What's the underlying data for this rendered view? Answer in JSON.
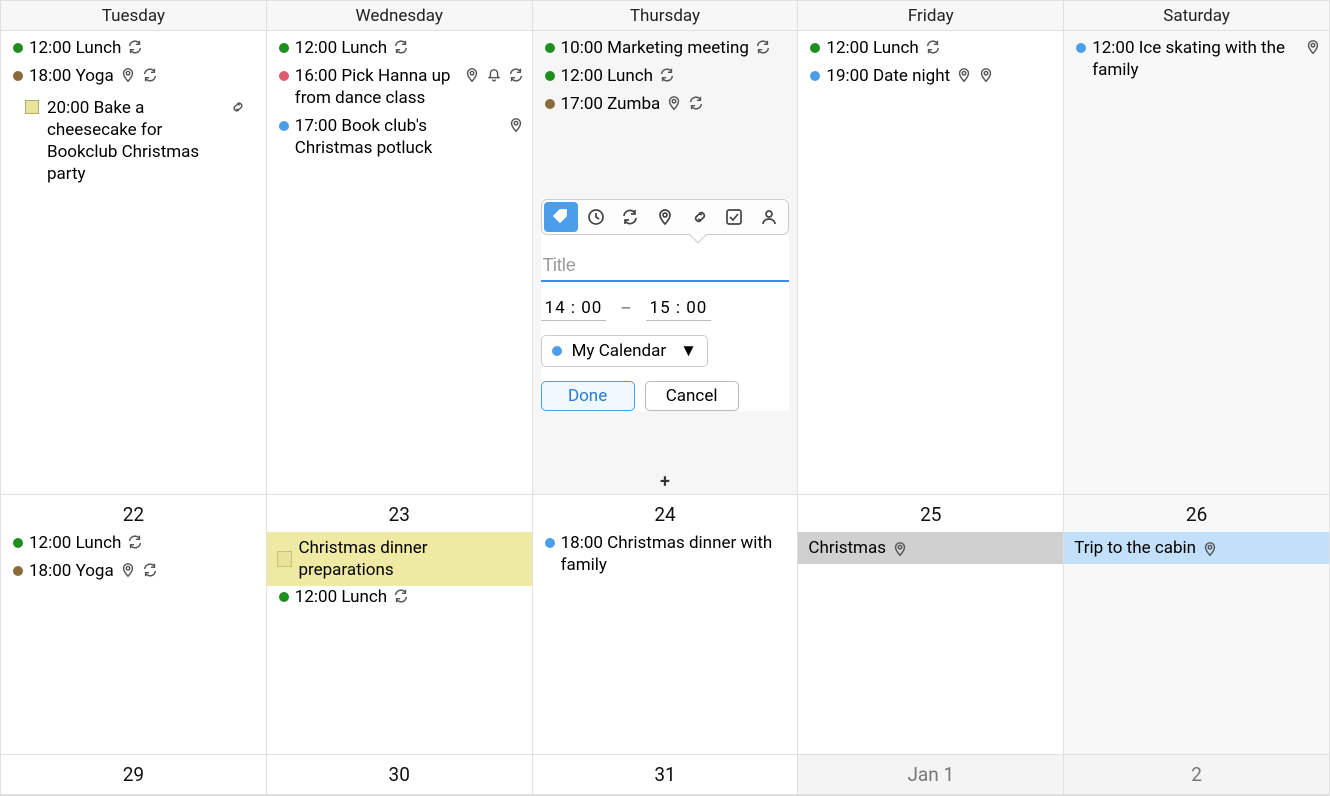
{
  "header": [
    "Tuesday",
    "Wednesday",
    "Thursday",
    "Friday",
    "Saturday"
  ],
  "weeks": [
    {
      "days": [
        {
          "date": "",
          "events": [
            {
              "color": "green",
              "time": "12:00",
              "title": "Lunch",
              "icons": [
                "repeat"
              ]
            },
            {
              "color": "brown",
              "time": "18:00",
              "title": "Yoga",
              "icons": [
                "location",
                "repeat"
              ]
            }
          ],
          "allday": [
            {
              "type": "swatch",
              "color": "yellow",
              "time": "20:00",
              "title": "Bake a cheesecake for Bookclub Christmas party",
              "icons": [
                "link"
              ]
            }
          ]
        },
        {
          "date": "",
          "events": [
            {
              "color": "green",
              "time": "12:00",
              "title": "Lunch",
              "icons": [
                "repeat"
              ]
            },
            {
              "color": "pink",
              "time": "16:00",
              "title": "Pick Hanna up from dance class",
              "icons": [
                "location",
                "bell",
                "repeat"
              ]
            },
            {
              "color": "blue",
              "time": "17:00",
              "title": "Book club's Christmas potluck",
              "icons": [
                "location"
              ]
            }
          ]
        },
        {
          "date": "",
          "today": true,
          "add": true,
          "events": [
            {
              "color": "green",
              "time": "10:00",
              "title": "Marketing meeting",
              "icons": [
                "repeat"
              ]
            },
            {
              "color": "green",
              "time": "12:00",
              "title": "Lunch",
              "icons": [
                "repeat"
              ]
            },
            {
              "color": "brown",
              "time": "17:00",
              "title": "Zumba",
              "icons": [
                "location",
                "repeat"
              ]
            }
          ],
          "popup": {
            "title_placeholder": "Title",
            "start": "14 : 00",
            "end": "15 : 00",
            "calendar": "My Calendar",
            "done": "Done",
            "cancel": "Cancel"
          }
        },
        {
          "date": "",
          "events": [
            {
              "color": "green",
              "time": "12:00",
              "title": "Lunch",
              "icons": [
                "repeat"
              ]
            },
            {
              "color": "blue",
              "time": "19:00",
              "title": "Date night",
              "icons": [
                "location",
                "location"
              ]
            }
          ]
        },
        {
          "date": "",
          "weekend": true,
          "events": [
            {
              "color": "blue",
              "time": "12:00",
              "title": "Ice skating with the family",
              "icons": [
                "location"
              ]
            }
          ]
        }
      ]
    },
    {
      "days": [
        {
          "date": "22",
          "events": [
            {
              "color": "green",
              "time": "12:00",
              "title": "Lunch",
              "icons": [
                "repeat"
              ]
            },
            {
              "color": "brown",
              "time": "18:00",
              "title": "Yoga",
              "icons": [
                "location",
                "repeat"
              ]
            }
          ]
        },
        {
          "date": "23",
          "alldaybar": [
            {
              "bg": "yellow",
              "swatch": "yellow",
              "title": "Christmas dinner preparations"
            }
          ],
          "events": [
            {
              "color": "green",
              "time": "12:00",
              "title": "Lunch",
              "icons": [
                "repeat"
              ]
            }
          ]
        },
        {
          "date": "24",
          "events": [
            {
              "color": "blue",
              "time": "18:00",
              "title": "Christmas dinner with family",
              "icons": []
            }
          ]
        },
        {
          "date": "25",
          "alldaybar": [
            {
              "bg": "grey",
              "title": "Christmas",
              "icons": [
                "location"
              ]
            }
          ]
        },
        {
          "date": "26",
          "weekend": true,
          "alldaybar": [
            {
              "bg": "blue",
              "title": "Trip to the cabin",
              "icons": [
                "location"
              ]
            }
          ]
        }
      ]
    },
    {
      "small": true,
      "days": [
        {
          "date": "29"
        },
        {
          "date": "30"
        },
        {
          "date": "31"
        },
        {
          "date": "Jan  1",
          "other": true
        },
        {
          "date": "2",
          "other": true,
          "weekend": true
        }
      ]
    }
  ]
}
